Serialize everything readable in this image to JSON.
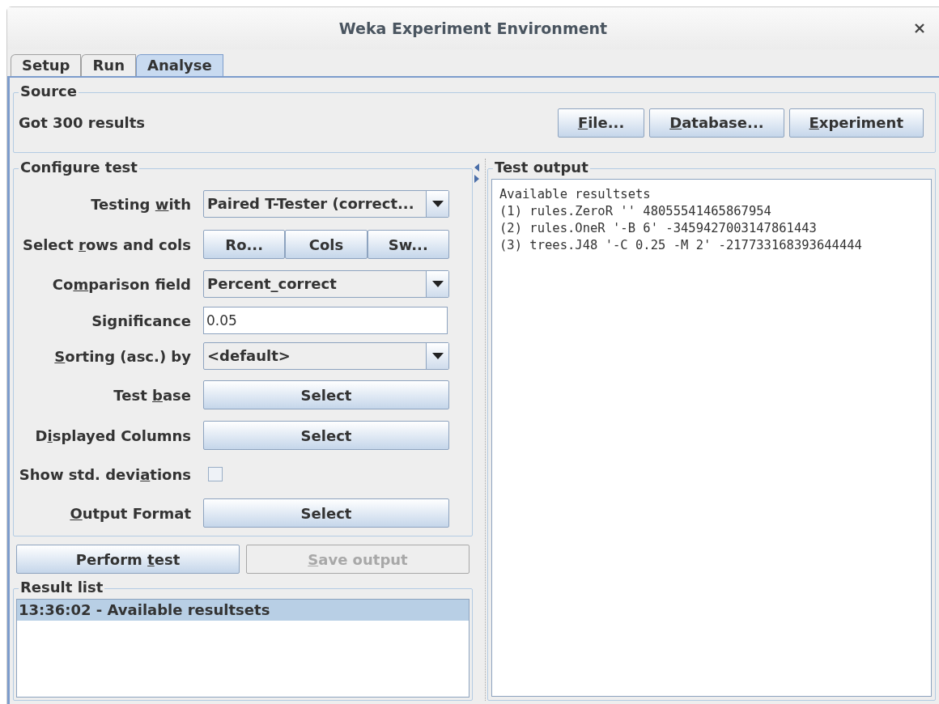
{
  "window": {
    "title": "Weka Experiment Environment"
  },
  "tabs": [
    {
      "label": "Setup",
      "selected": false
    },
    {
      "label": "Run",
      "selected": false
    },
    {
      "label": "Analyse",
      "selected": true
    }
  ],
  "source": {
    "title": "Source",
    "status": "Got 300 results",
    "buttons": [
      {
        "label": {
          "key": "F",
          "after": "ile..."
        }
      },
      {
        "label": {
          "key": "D",
          "after": "atabase..."
        }
      },
      {
        "label": {
          "key": "E",
          "after": "xperiment"
        }
      }
    ]
  },
  "configure": {
    "title": "Configure test",
    "rows": [
      {
        "kind": "combo",
        "label": {
          "before": "Testing ",
          "key": "w",
          "after": "ith"
        },
        "value": "Paired T-Tester (correct..."
      },
      {
        "kind": "buttons",
        "label": {
          "before": "Select ",
          "key": "r",
          "after": "ows and cols"
        },
        "buttons": [
          "Ro...",
          "Cols",
          "Sw..."
        ]
      },
      {
        "kind": "combo",
        "label": {
          "before": "Co",
          "key": "m",
          "after": "parison field"
        },
        "value": "Percent_correct"
      },
      {
        "kind": "text",
        "label": {
          "before": "Si",
          "key": "g",
          "after": "nificance"
        },
        "value": "0.05"
      },
      {
        "kind": "combo",
        "label": {
          "key": "S",
          "after": "orting (asc.) by"
        },
        "value": "<default>"
      },
      {
        "kind": "button",
        "label": {
          "before": "Test ",
          "key": "b",
          "after": "ase"
        },
        "value": "Select"
      },
      {
        "kind": "button",
        "label": {
          "before": "D",
          "key": "i",
          "after": "splayed Columns"
        },
        "value": "Select"
      },
      {
        "kind": "checkbox",
        "label": {
          "before": "Show std. devi",
          "key": "a",
          "after": "tions"
        },
        "checked": false
      },
      {
        "kind": "button",
        "label": {
          "key": "O",
          "after": "utput Format"
        },
        "value": "Select"
      }
    ]
  },
  "actions": [
    {
      "label": {
        "before": "Perform ",
        "key": "t",
        "after": "est"
      },
      "disabled": false
    },
    {
      "label": {
        "key": "S",
        "after": "ave output"
      },
      "disabled": true
    }
  ],
  "result_list": {
    "title": "Result list",
    "items": [
      {
        "text": "13:36:02 - Available resultsets",
        "selected": true
      }
    ]
  },
  "output": {
    "title": "Test output",
    "lines": [
      "Available resultsets",
      "(1) rules.ZeroR '' 48055541465867954",
      "(2) rules.OneR '-B 6' -3459427003147861443",
      "(3) trees.J48 '-C 0.25 -M 2' -217733168393644444"
    ]
  }
}
